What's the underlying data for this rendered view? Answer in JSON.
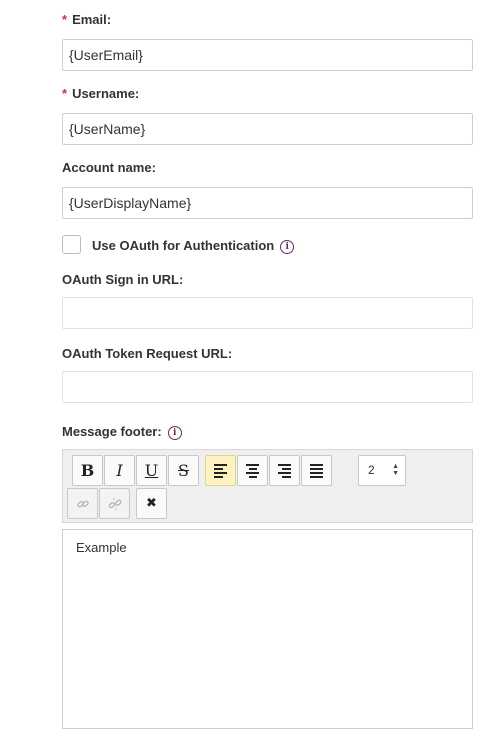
{
  "form": {
    "email": {
      "label": "Email:",
      "required_mark": "*",
      "value": "{UserEmail}"
    },
    "username": {
      "label": "Username:",
      "required_mark": "*",
      "value": "{UserName}"
    },
    "account_name": {
      "label": "Account name:",
      "value": "{UserDisplayName}"
    },
    "oauth_checkbox": {
      "label": "Use OAuth for Authentication",
      "checked": false,
      "info_icon": "info-icon"
    },
    "oauth_sign_in_url": {
      "label": "OAuth Sign in URL:",
      "value": ""
    },
    "oauth_token_url": {
      "label": "OAuth Token Request URL:",
      "value": ""
    },
    "message_footer": {
      "label": "Message footer:",
      "info_icon": "info-icon"
    }
  },
  "toolbar": {
    "bold": "B",
    "italic": "I",
    "underline": "U",
    "strike": "S",
    "font_size": "2",
    "active_align": "left",
    "remove_format": "✖"
  },
  "editor": {
    "content": "Example"
  },
  "colors": {
    "required": "#d0342c",
    "info_icon": "#6a2c5e",
    "active_button": "#fff2c2"
  }
}
